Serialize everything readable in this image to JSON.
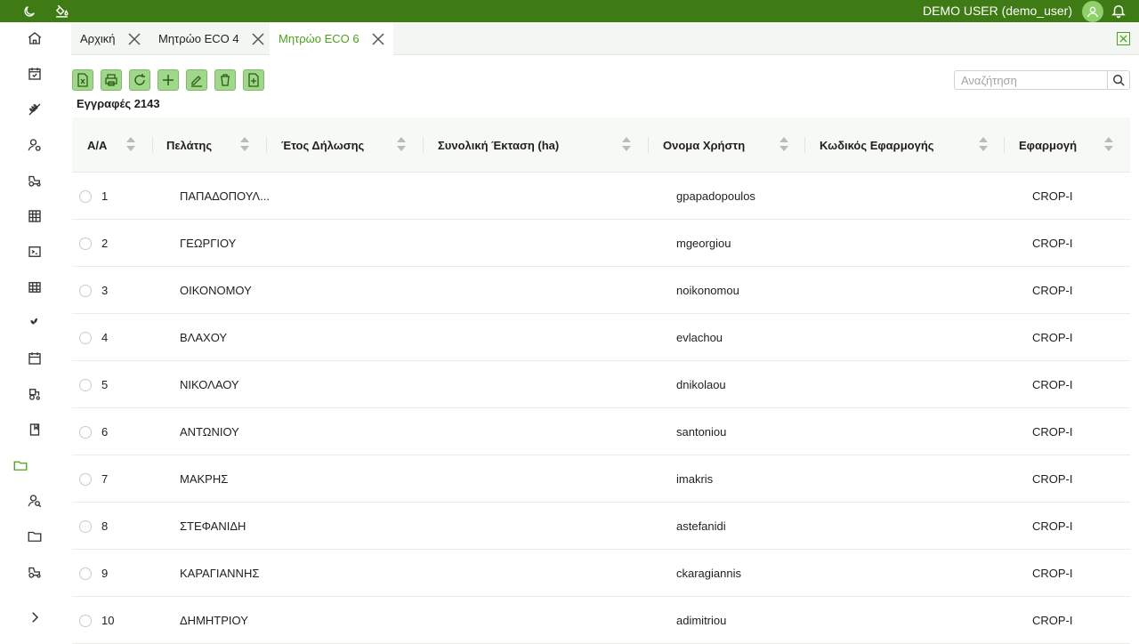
{
  "topbar": {
    "user_label": "DEMO USER (demo_user)",
    "icons": [
      "moon-icon",
      "paint-bucket-icon",
      "avatar-icon",
      "bell-icon"
    ],
    "bg_color": "#3f7b14"
  },
  "sidebar": {
    "items": [
      "home-icon",
      "calendar-check-icon",
      "wheat-icon",
      "user-settings-icon",
      "tractor-icon",
      "warehouse-icon",
      "terminal-icon",
      "grid-icon",
      "plant-icon",
      "calendar-icon",
      "harvester-icon",
      "book-icon",
      "folder-icon",
      "user-search-icon",
      "folder-icon",
      "tractor-icon",
      "expand-chevron-icon"
    ],
    "active_index": 12
  },
  "tabs": [
    {
      "label": "Αρχική"
    },
    {
      "label": "Μητρώο ECO 4"
    },
    {
      "label": "Μητρώο ECO 6"
    }
  ],
  "active_tab": 2,
  "toolbar": {
    "buttons": [
      "excel-export-icon",
      "print-icon",
      "refresh-icon",
      "add-icon",
      "edit-icon",
      "delete-icon",
      "file-export-icon"
    ]
  },
  "records_label": "Εγγραφές 2143",
  "search": {
    "placeholder": "Αναζήτηση",
    "value": ""
  },
  "table": {
    "columns": [
      "Α/Α",
      "Πελάτης",
      "Έτος Δήλωσης",
      "Συνολική Έκταση (ha)",
      "Ονομα Χρήστη",
      "Κωδικός Εφαρμογής",
      "Εφαρμογή"
    ],
    "rows": [
      [
        "1",
        "ΠΑΠΑΔΟΠΟΥΛ...",
        "",
        "",
        "gpapadopoulos",
        "",
        "CROP-I"
      ],
      [
        "2",
        "ΓΕΩΡΓΙΟΥ",
        "",
        "",
        "mgeorgiou",
        "",
        "CROP-I"
      ],
      [
        "3",
        "ΟΙΚΟΝΟΜΟΥ",
        "",
        "",
        "noikonomou",
        "",
        "CROP-I"
      ],
      [
        "4",
        "ΒΛΑΧΟΥ",
        "",
        "",
        "evlachou",
        "",
        "CROP-I"
      ],
      [
        "5",
        "ΝΙΚΟΛΑΟΥ",
        "",
        "",
        "dnikolaou",
        "",
        "CROP-I"
      ],
      [
        "6",
        "ΑΝΤΩΝΙΟΥ",
        "",
        "",
        "santoniou",
        "",
        "CROP-I"
      ],
      [
        "7",
        "ΜΑΚΡΗΣ",
        "",
        "",
        "imakris",
        "",
        "CROP-I"
      ],
      [
        "8",
        "ΣΤΕΦΑΝΙΔΗ",
        "",
        "",
        "astefanidi",
        "",
        "CROP-I"
      ],
      [
        "9",
        "ΚΑΡΑΓΙΑΝΝΗΣ",
        "",
        "",
        "ckaragiannis",
        "",
        "CROP-I"
      ],
      [
        "10",
        "ΔΗΜΗΤΡΙΟΥ",
        "",
        "",
        "adimitriou",
        "",
        "CROP-I"
      ]
    ]
  }
}
